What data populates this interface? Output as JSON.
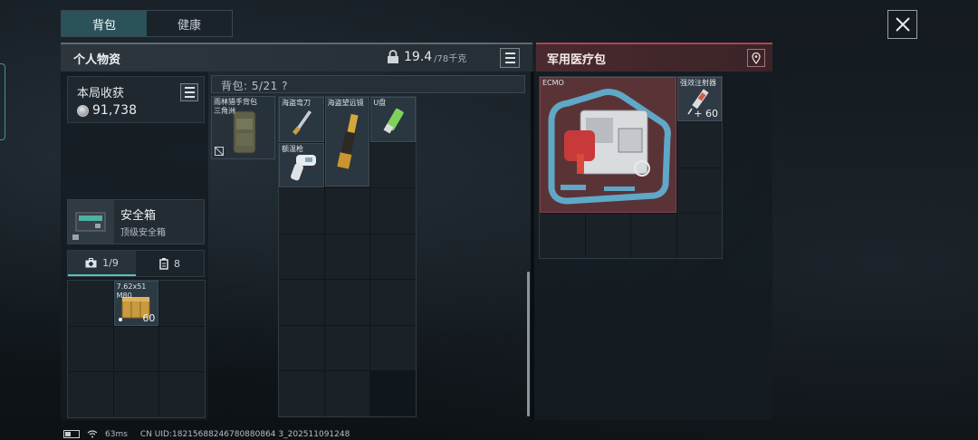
{
  "tabs": [
    {
      "label": "背包",
      "active": true
    },
    {
      "label": "健康",
      "active": false
    }
  ],
  "left_panel": {
    "title": "个人物资",
    "weight_value": "19.4",
    "weight_unit": "/78千克"
  },
  "harvest": {
    "title": "本局收获",
    "amount": "91,738"
  },
  "safebox": {
    "title": "安全箱",
    "subtitle": "顶级安全箱"
  },
  "subtabs": [
    {
      "label": "1/9",
      "icon": "medkit-icon",
      "active": true
    },
    {
      "label": "8",
      "icon": "magazine-icon",
      "active": false
    }
  ],
  "ammo": {
    "label_line1": "7.62x51",
    "label_line2": "M80",
    "count": "60"
  },
  "backpack": {
    "header": "背包: 5/21 ?",
    "equipped_label_1": "雨林猎手背包",
    "equipped_label_2": "三角洲",
    "items": [
      {
        "name": "海盗弯刀",
        "icon": "knife-icon"
      },
      {
        "name": "海盗望远镜",
        "icon": "spyglass-icon"
      },
      {
        "name": "U盘",
        "icon": "usb-icon"
      },
      {
        "name": "额温枪",
        "icon": "thermometer-icon"
      }
    ]
  },
  "medical": {
    "title": "军用医疗包",
    "ecmo_label": "ECMO",
    "injector_label": "强效注射器",
    "injector_count": "+ 60"
  },
  "status": {
    "ping": "63ms",
    "uid": "CN UID:18215688246780880864 3_202511091248"
  },
  "colors": {
    "accent_teal": "#2b5258",
    "medical_red": "#b04450",
    "ecmo_bg": "#5a3337"
  }
}
